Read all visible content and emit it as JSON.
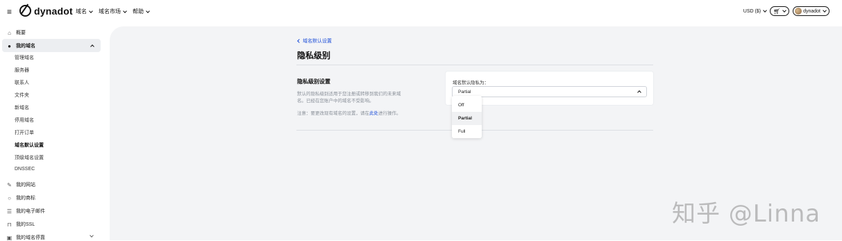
{
  "header": {
    "menu_icon": "hamburger-icon",
    "brand": "dynadot",
    "nav": [
      "域名",
      "域名市场",
      "帮助"
    ],
    "currency": "USD ($)",
    "cart_icon": "cart-icon",
    "username": "dynadot"
  },
  "sidebar": {
    "overview": "概要",
    "my_domains": "我的域名",
    "sub_items": [
      "管理域名",
      "服务器",
      "联系人",
      "文件夹",
      "新域名",
      "停用域名",
      "打开订单",
      "域名默认设置",
      "顶级域名设置",
      "DNSSEC"
    ],
    "active_sub": "域名默认设置",
    "my_sites": "我的网站",
    "my_trademarks": "我的商标",
    "my_email": "我的电子邮件",
    "my_ssl": "我的SSL",
    "my_parking": "我的域名停靠"
  },
  "main": {
    "back_link": "域名默认设置",
    "title": "隐私级别",
    "section_title": "隐私级别设置",
    "desc1": "默认的隐私级别适用于您注册或转移到我们的未来域名。已经在您账户中的域名不受影响。",
    "desc2_pre": "注意：要更改现有域名的设置，请在",
    "desc2_link": "此处",
    "desc2_post": "进行操作。",
    "field_label": "域名默认隐私为：",
    "selected_value": "Partial",
    "options": [
      "Off",
      "Partial",
      "Full"
    ]
  },
  "watermark": "知乎 @Linna",
  "colors": {
    "accent": "#1d4ed8",
    "panel": "#f3f4f6"
  }
}
